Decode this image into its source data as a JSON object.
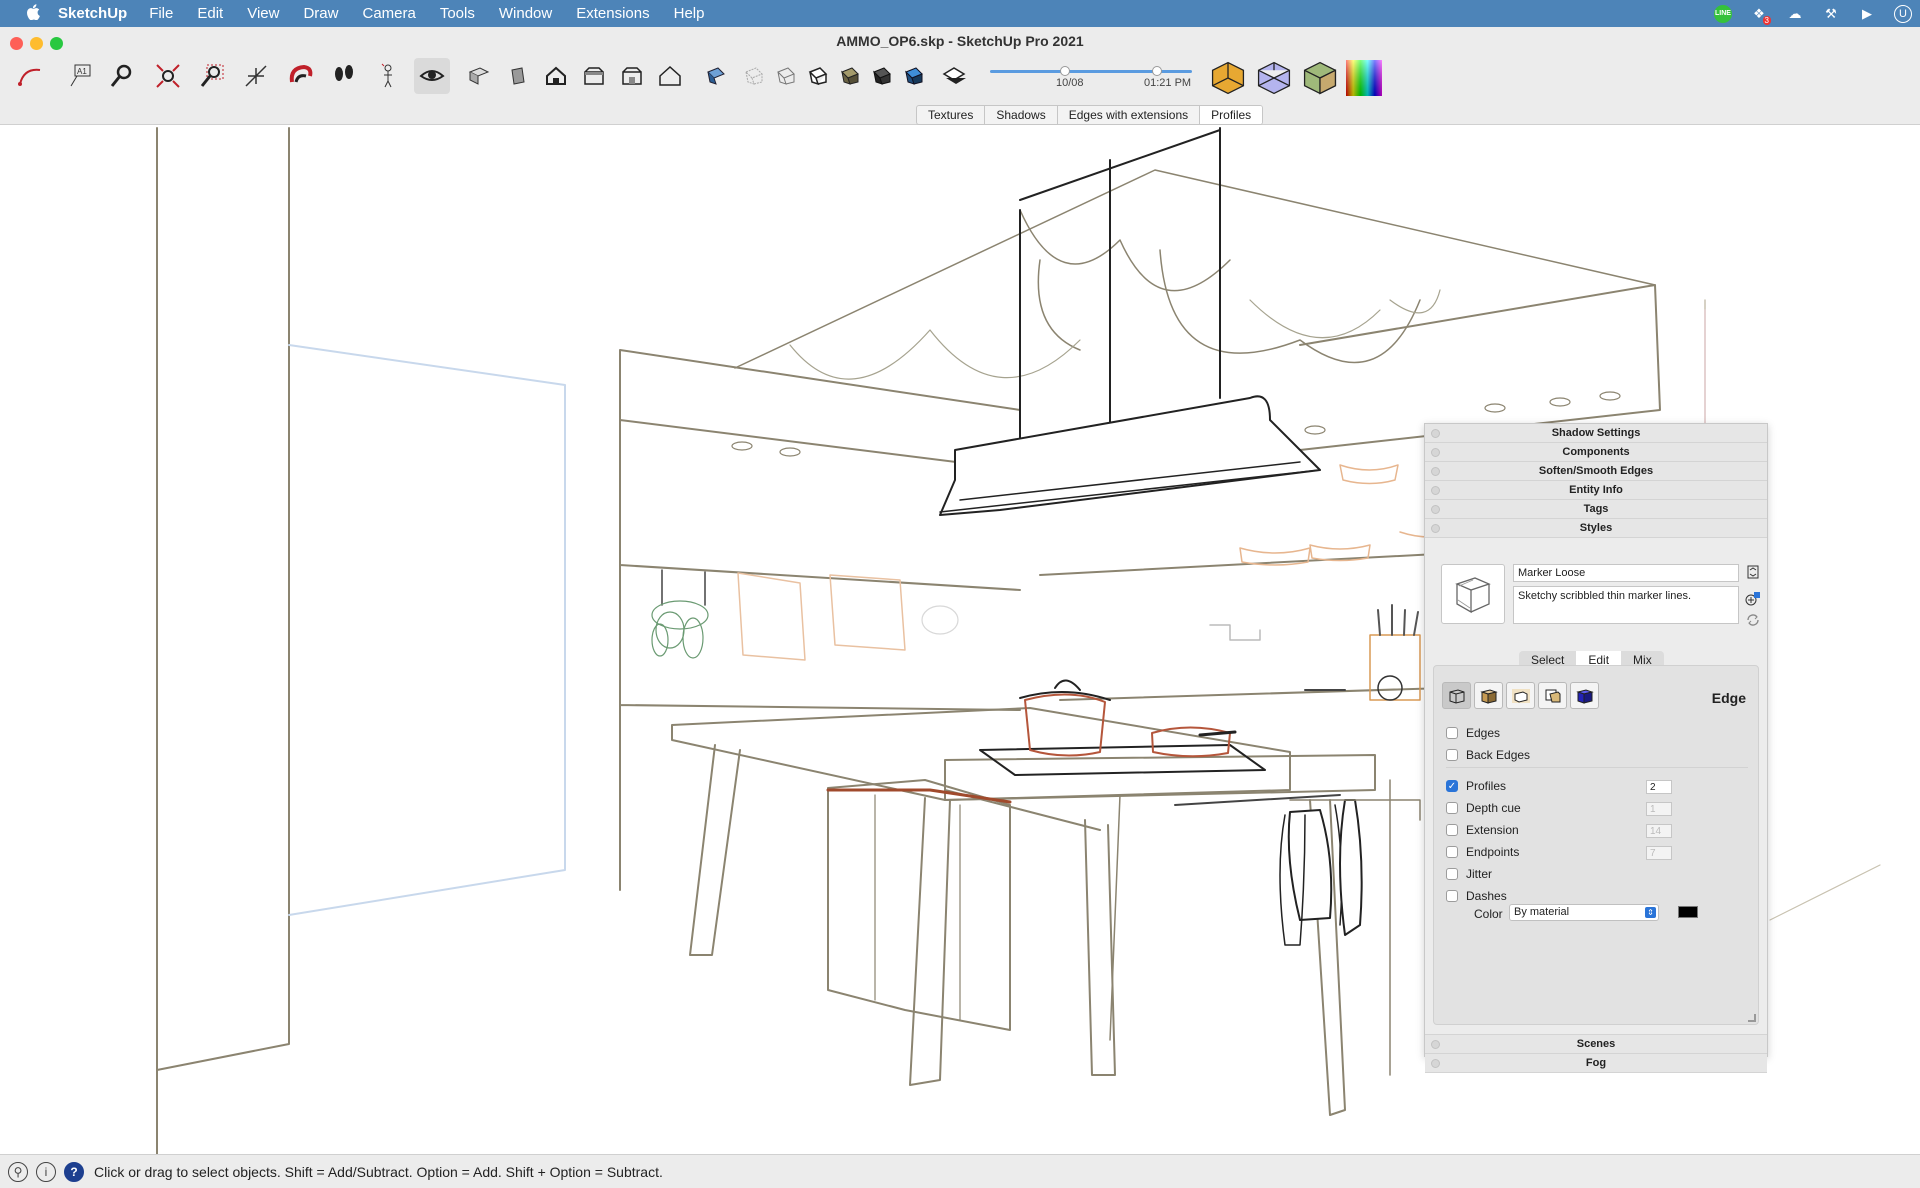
{
  "menubar": {
    "app_name": "SketchUp",
    "items": [
      "File",
      "Edit",
      "View",
      "Draw",
      "Camera",
      "Tools",
      "Window",
      "Extensions",
      "Help"
    ],
    "tray_line": "LINE",
    "tray_badge": "3",
    "tray_user": "U"
  },
  "window": {
    "title": "AMMO_OP6.skp - SketchUp Pro 2021"
  },
  "shadow": {
    "date": "10/08",
    "time": "01:21 PM"
  },
  "scene_tabs": [
    "Textures",
    "Shadows",
    "Edges with extensions",
    "Profiles"
  ],
  "active_tab": "Profiles",
  "tray": {
    "panels_top": [
      "Shadow Settings",
      "Components",
      "Soften/Smooth Edges",
      "Entity Info",
      "Tags",
      "Styles"
    ],
    "styles": {
      "name": "Marker Loose",
      "description": "Sketchy scribbled thin marker lines.",
      "tabs": [
        "Select",
        "Edit",
        "Mix"
      ],
      "active_tab": "Edit",
      "mode_label": "Edge",
      "options": [
        {
          "label": "Edges",
          "checked": false,
          "value": null
        },
        {
          "label": "Back Edges",
          "checked": false,
          "value": null
        },
        {
          "label": "Profiles",
          "checked": true,
          "value": "2"
        },
        {
          "label": "Depth cue",
          "checked": false,
          "value": "1"
        },
        {
          "label": "Extension",
          "checked": false,
          "value": "14"
        },
        {
          "label": "Endpoints",
          "checked": false,
          "value": "7"
        },
        {
          "label": "Jitter",
          "checked": false,
          "value": null
        },
        {
          "label": "Dashes",
          "checked": false,
          "value": null
        }
      ],
      "color_label": "Color",
      "color_value": "By material",
      "color_swatch": "#000000"
    },
    "panels_bottom": [
      "Scenes",
      "Fog"
    ]
  },
  "status": {
    "text": "Click or drag to select objects. Shift = Add/Subtract. Option = Add. Shift + Option = Subtract."
  }
}
